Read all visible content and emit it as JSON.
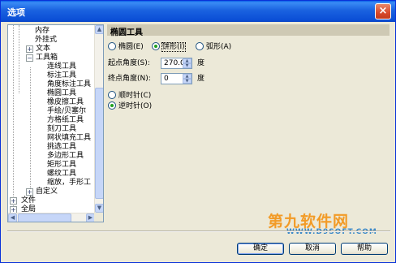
{
  "window": {
    "title": "选项",
    "close_label": "×"
  },
  "tree": {
    "items": [
      {
        "label": "内存"
      },
      {
        "label": "外挂式"
      },
      {
        "label": "文本",
        "expander": "+"
      },
      {
        "label": "工具箱",
        "expander": "−"
      },
      {
        "label": "连线工具"
      },
      {
        "label": "标注工具"
      },
      {
        "label": "角度标注工具"
      },
      {
        "label": "椭圆工具"
      },
      {
        "label": "橡皮擦工具"
      },
      {
        "label": "手绘/贝塞尔"
      },
      {
        "label": "方格纸工具"
      },
      {
        "label": "刻刀工具"
      },
      {
        "label": "网状填充工具"
      },
      {
        "label": "挑选工具"
      },
      {
        "label": "多边形工具"
      },
      {
        "label": "矩形工具"
      },
      {
        "label": "螺纹工具"
      },
      {
        "label": "缩放，手形工"
      },
      {
        "label": "自定义",
        "expander": "+"
      },
      {
        "label": "文件",
        "expander": "+"
      },
      {
        "label": "全局",
        "expander": "+"
      }
    ],
    "scroll_up": "▲",
    "scroll_down": "▼",
    "scroll_left": "◀",
    "scroll_right": "▶"
  },
  "panel": {
    "header": "椭圆工具",
    "type_options": [
      {
        "label": "椭圆(E)",
        "selected": false
      },
      {
        "label": "饼形(I)",
        "selected": true
      },
      {
        "label": "弧形(A)",
        "selected": false
      }
    ],
    "start_angle": {
      "label": "起点角度(S):",
      "value": "270.0",
      "unit": "度"
    },
    "end_angle": {
      "label": "终点角度(N):",
      "value": "0",
      "unit": "度"
    },
    "direction_options": [
      {
        "label": "顺时针(C)",
        "selected": false
      },
      {
        "label": "逆时针(O)",
        "selected": true
      }
    ]
  },
  "buttons": {
    "ok": "确定",
    "cancel": "取消",
    "help": "帮助"
  },
  "watermark": {
    "main": "第九软件网",
    "sub": "WWW.D9SOFT.COM"
  },
  "colors": {
    "titlebar": "#0a5ee8",
    "accent_green": "#21a121",
    "watermark": "#f29b27"
  }
}
